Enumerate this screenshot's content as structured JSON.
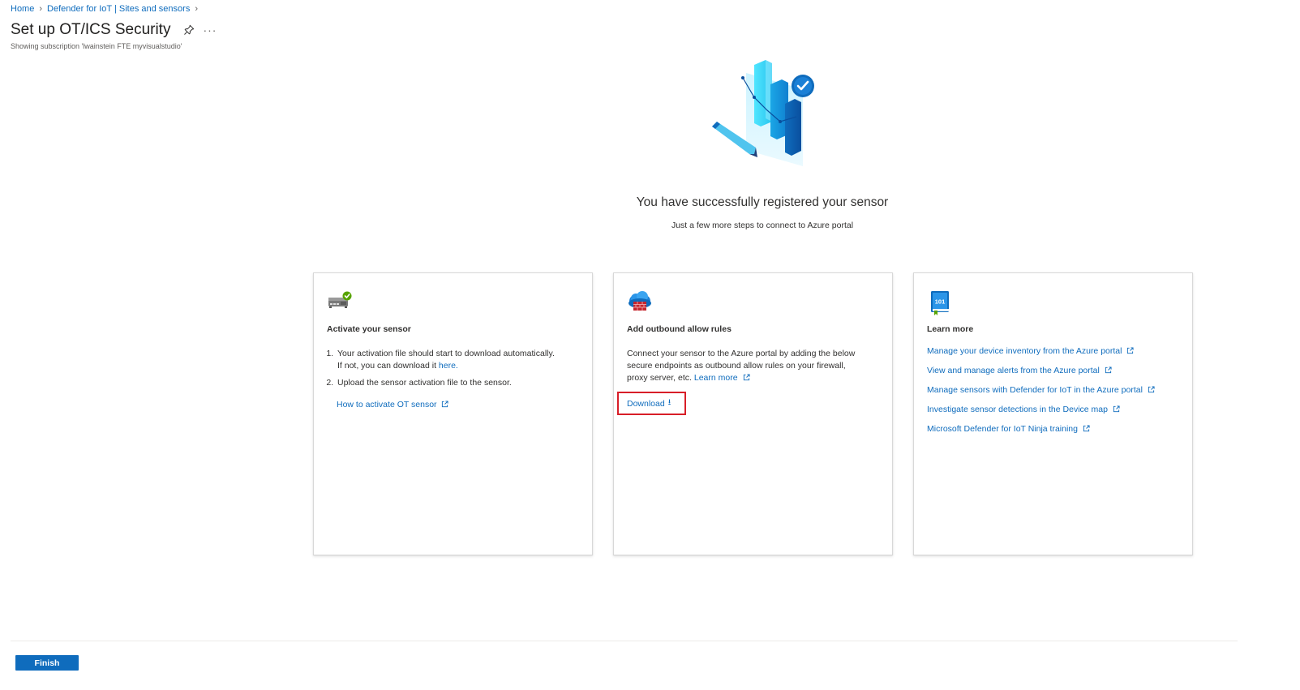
{
  "breadcrumb": {
    "items": [
      "Home",
      "Defender for IoT | Sites and sensors"
    ]
  },
  "page": {
    "title": "Set up OT/ICS Security",
    "subscription": "Showing subscription 'lwainstein FTE myvisualstudio'"
  },
  "hero": {
    "title": "You have successfully registered your sensor",
    "subtitle": "Just a few more steps to connect to Azure portal"
  },
  "cards": {
    "activate": {
      "icon": "sensor-check-icon",
      "title": "Activate your sensor",
      "step1_text": "Your activation file should start to download automatically. If not, you can download it",
      "step1_link": "here.",
      "step2_text": "Upload the sensor activation file to the sensor.",
      "link": "How to activate OT sensor"
    },
    "outbound": {
      "icon": "cloud-firewall-icon",
      "title": "Add outbound allow rules",
      "body": "Connect your sensor to the Azure portal by adding the below secure endpoints as outbound allow rules on your firewall, proxy server, etc.",
      "learn_more": "Learn more",
      "download": "Download"
    },
    "learn": {
      "icon": "book-101-icon",
      "title": "Learn more",
      "links": [
        "Manage your device inventory from the Azure portal",
        "View and manage alerts from the Azure portal",
        "Manage sensors with Defender for IoT in the Azure portal",
        "Investigate sensor detections in the Device map",
        "Microsoft Defender for IoT Ninja training"
      ]
    }
  },
  "footer": {
    "finish": "Finish"
  },
  "colors": {
    "link": "#0f6cbd",
    "accent": "#0f6cbd",
    "highlight_border": "#d81e28"
  }
}
